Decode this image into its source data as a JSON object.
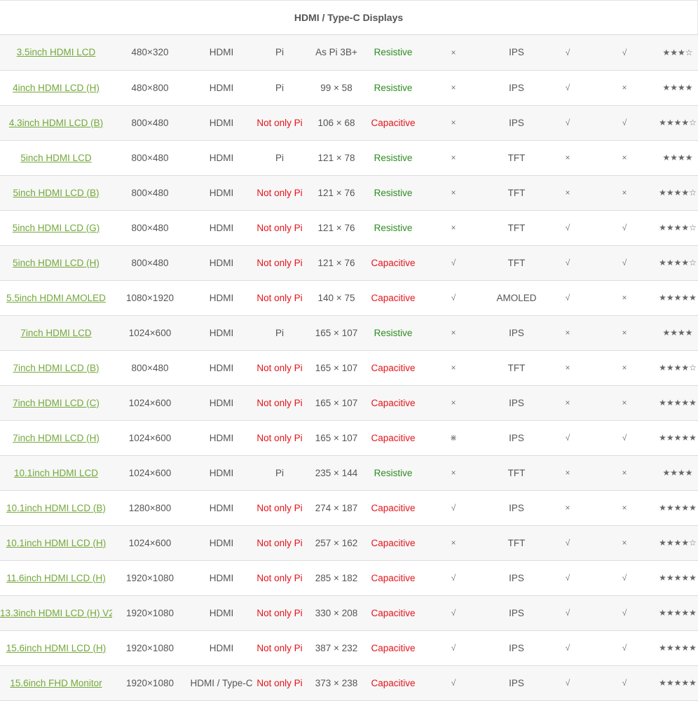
{
  "title": "HDMI / Type-C Displays",
  "colors": {
    "link": "#73a839",
    "pi_red": "#e4141b",
    "resistive_green": "#2e8b22",
    "text": "#555555"
  },
  "rows": [
    {
      "name": "3.5inch HDMI LCD",
      "resolution": "480×320",
      "interface": "HDMI",
      "compat": "Pi",
      "size": "As Pi 3B+",
      "touch": "Resistive",
      "c7": "×",
      "panel": "IPS",
      "c9": "√",
      "c10": "√",
      "rating": "★★★☆"
    },
    {
      "name": "4inch HDMI LCD (H)",
      "resolution": "480×800",
      "interface": "HDMI",
      "compat": "Pi",
      "size": "99 × 58",
      "touch": "Resistive",
      "c7": "×",
      "panel": "IPS",
      "c9": "√",
      "c10": "×",
      "rating": "★★★★"
    },
    {
      "name": "4.3inch HDMI LCD (B)",
      "resolution": "800×480",
      "interface": "HDMI",
      "compat": "Not only Pi",
      "size": "106 × 68",
      "touch": "Capacitive",
      "c7": "×",
      "panel": "IPS",
      "c9": "√",
      "c10": "√",
      "rating": "★★★★☆"
    },
    {
      "name": "5inch HDMI LCD",
      "resolution": "800×480",
      "interface": "HDMI",
      "compat": "Pi",
      "size": "121 × 78",
      "touch": "Resistive",
      "c7": "×",
      "panel": "TFT",
      "c9": "×",
      "c10": "×",
      "rating": "★★★★"
    },
    {
      "name": "5inch HDMI LCD (B)",
      "resolution": "800×480",
      "interface": "HDMI",
      "compat": "Not only Pi",
      "size": "121 × 76",
      "touch": "Resistive",
      "c7": "×",
      "panel": "TFT",
      "c9": "×",
      "c10": "×",
      "rating": "★★★★☆"
    },
    {
      "name": "5inch HDMI LCD (G)",
      "resolution": "800×480",
      "interface": "HDMI",
      "compat": "Not only Pi",
      "size": "121 × 76",
      "touch": "Resistive",
      "c7": "×",
      "panel": "TFT",
      "c9": "√",
      "c10": "√",
      "rating": "★★★★☆"
    },
    {
      "name": "5inch HDMI LCD (H)",
      "resolution": "800×480",
      "interface": "HDMI",
      "compat": "Not only Pi",
      "size": "121 × 76",
      "touch": "Capacitive",
      "c7": "√",
      "panel": "TFT",
      "c9": "√",
      "c10": "√",
      "rating": "★★★★☆"
    },
    {
      "name": "5.5inch HDMI AMOLED",
      "resolution": "1080×1920",
      "interface": "HDMI",
      "compat": "Not only Pi",
      "size": "140 × 75",
      "touch": "Capacitive",
      "c7": "√",
      "panel": "AMOLED",
      "c9": "√",
      "c10": "×",
      "rating": "★★★★★"
    },
    {
      "name": "7inch HDMI LCD",
      "resolution": "1024×600",
      "interface": "HDMI",
      "compat": "Pi",
      "size": "165 × 107",
      "touch": "Resistive",
      "c7": "×",
      "panel": "IPS",
      "c9": "×",
      "c10": "×",
      "rating": "★★★★"
    },
    {
      "name": "7inch HDMI LCD (B)",
      "resolution": "800×480",
      "interface": "HDMI",
      "compat": "Not only Pi",
      "size": "165 × 107",
      "touch": "Capacitive",
      "c7": "×",
      "panel": "TFT",
      "c9": "×",
      "c10": "×",
      "rating": "★★★★☆"
    },
    {
      "name": "7inch HDMI LCD (C)",
      "resolution": "1024×600",
      "interface": "HDMI",
      "compat": "Not only Pi",
      "size": "165 × 107",
      "touch": "Capacitive",
      "c7": "×",
      "panel": "IPS",
      "c9": "×",
      "c10": "×",
      "rating": "★★★★★"
    },
    {
      "name": "7inch HDMI LCD (H)",
      "resolution": "1024×600",
      "interface": "HDMI",
      "compat": "Not only Pi",
      "size": "165 × 107",
      "touch": "Capacitive",
      "c7": "⋇",
      "panel": "IPS",
      "c9": "√",
      "c10": "√",
      "rating": "★★★★★"
    },
    {
      "name": "10.1inch HDMI LCD",
      "resolution": "1024×600",
      "interface": "HDMI",
      "compat": "Pi",
      "size": "235 × 144",
      "touch": "Resistive",
      "c7": "×",
      "panel": "TFT",
      "c9": "×",
      "c10": "×",
      "rating": "★★★★"
    },
    {
      "name": "10.1inch HDMI LCD (B)",
      "resolution": "1280×800",
      "interface": "HDMI",
      "compat": "Not only Pi",
      "size": "274 × 187",
      "touch": "Capacitive",
      "c7": "√",
      "panel": "IPS",
      "c9": "×",
      "c10": "×",
      "rating": "★★★★★"
    },
    {
      "name": "10.1inch HDMI LCD (H)",
      "resolution": "1024×600",
      "interface": "HDMI",
      "compat": "Not only Pi",
      "size": "257 × 162",
      "touch": "Capacitive",
      "c7": "×",
      "panel": "TFT",
      "c9": "√",
      "c10": "×",
      "rating": "★★★★☆"
    },
    {
      "name": "11.6inch HDMI LCD (H)",
      "resolution": "1920×1080",
      "interface": "HDMI",
      "compat": "Not only Pi",
      "size": "285 × 182",
      "touch": "Capacitive",
      "c7": "√",
      "panel": "IPS",
      "c9": "√",
      "c10": "√",
      "rating": "★★★★★"
    },
    {
      "name": "13.3inch HDMI LCD (H) V2",
      "resolution": "1920×1080",
      "interface": "HDMI",
      "compat": "Not only Pi",
      "size": "330 × 208",
      "touch": "Capacitive",
      "c7": "√",
      "panel": "IPS",
      "c9": "√",
      "c10": "√",
      "rating": "★★★★★"
    },
    {
      "name": "15.6inch HDMI LCD (H)",
      "resolution": "1920×1080",
      "interface": "HDMI",
      "compat": "Not only Pi",
      "size": "387 × 232",
      "touch": "Capacitive",
      "c7": "√",
      "panel": "IPS",
      "c9": "√",
      "c10": "√",
      "rating": "★★★★★"
    },
    {
      "name": "15.6inch FHD Monitor",
      "resolution": "1920×1080",
      "interface": "HDMI / Type-C",
      "compat": "Not only Pi",
      "size": "373 × 238",
      "touch": "Capacitive",
      "c7": "√",
      "panel": "IPS",
      "c9": "√",
      "c10": "√",
      "rating": "★★★★★"
    }
  ]
}
